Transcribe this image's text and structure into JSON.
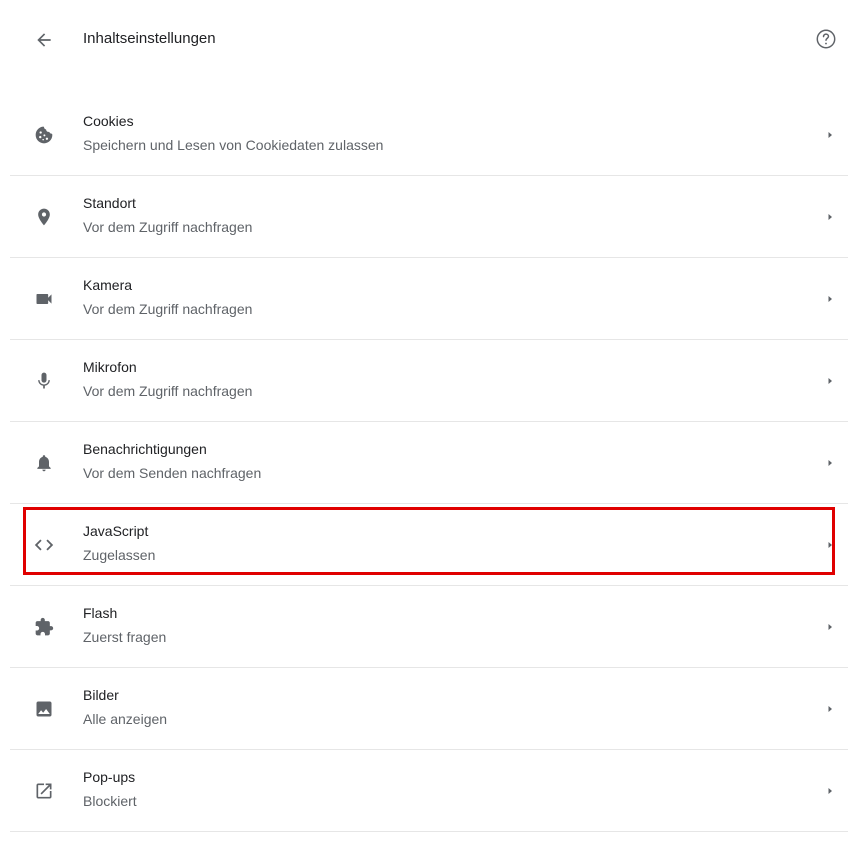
{
  "header": {
    "title": "Inhaltseinstellungen",
    "back_icon": "arrow-back-icon",
    "help_icon": "help-circle-icon"
  },
  "colors": {
    "highlight_border": "#e00000",
    "icon": "#5f6368",
    "divider": "#e6e6e6"
  },
  "settings": [
    {
      "title": "Cookies",
      "subtitle": "Speichern und Lesen von Cookiedaten zulassen",
      "icon": "cookie-icon"
    },
    {
      "title": "Standort",
      "subtitle": "Vor dem Zugriff nachfragen",
      "icon": "location-pin-icon"
    },
    {
      "title": "Kamera",
      "subtitle": "Vor dem Zugriff nachfragen",
      "icon": "videocam-icon"
    },
    {
      "title": "Mikrofon",
      "subtitle": "Vor dem Zugriff nachfragen",
      "icon": "mic-icon"
    },
    {
      "title": "Benachrichtigungen",
      "subtitle": "Vor dem Senden nachfragen",
      "icon": "bell-icon"
    },
    {
      "title": "JavaScript",
      "subtitle": "Zugelassen",
      "icon": "code-icon",
      "highlighted": true
    },
    {
      "title": "Flash",
      "subtitle": "Zuerst fragen",
      "icon": "puzzle-icon"
    },
    {
      "title": "Bilder",
      "subtitle": "Alle anzeigen",
      "icon": "image-icon"
    },
    {
      "title": "Pop-ups",
      "subtitle": "Blockiert",
      "icon": "open-in-new-icon"
    }
  ]
}
